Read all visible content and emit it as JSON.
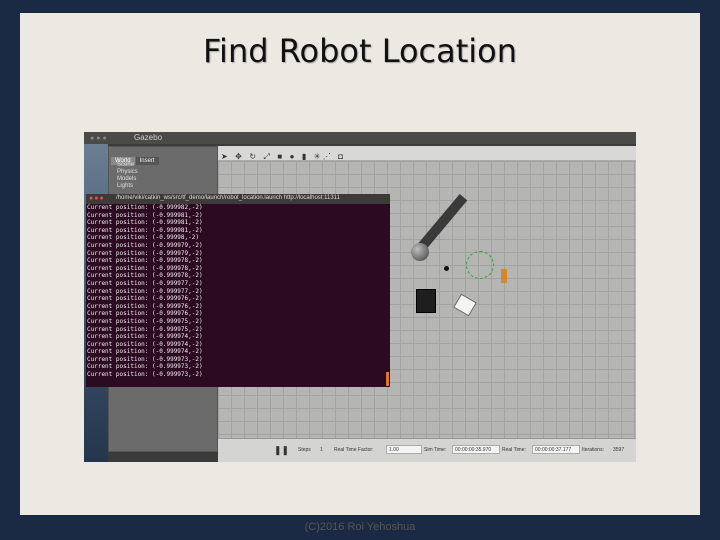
{
  "slide": {
    "title": "Find Robot Location",
    "footer": "(C)2016 Roi Yehoshua"
  },
  "gazebo": {
    "window_title": "Gazebo",
    "tabs": [
      "World",
      "Insert"
    ],
    "tree_items": [
      "Scene",
      "Physics",
      "Models",
      "Lights"
    ],
    "toolbar_icons": [
      "select-arrow-icon",
      "translate-icon",
      "rotate-icon",
      "scale-icon",
      "box-icon",
      "sphere-icon",
      "cylinder-icon",
      "light-icons",
      "screenshot-icon"
    ],
    "bottom": {
      "steps_label": "Steps",
      "steps_value": "1",
      "real_time_factor_label": "Real Time Factor:",
      "real_time_factor_value": "1.00",
      "sim_time_label": "Sim Time:",
      "sim_time_value": "00:00:00:35.970",
      "real_time_label": "Real Time:",
      "real_time_value": "00:00:00:37.177",
      "iterations_label": "Iterations:",
      "iterations_value": "3597"
    }
  },
  "terminal": {
    "title": "/home/viki/catkin_ws/src/tf_demo/launch/robot_location.launch http://localhost:11311",
    "lines": [
      "Current position: (-0.999982,-2)",
      "Current position: (-0.999981,-2)",
      "Current position: (-0.999981,-2)",
      "Current position: (-0.999981,-2)",
      "Current position: (-0.99998,-2)",
      "Current position: (-0.999979,-2)",
      "Current position: (-0.999979,-2)",
      "Current position: (-0.999978,-2)",
      "Current position: (-0.999978,-2)",
      "Current position: (-0.999978,-2)",
      "Current position: (-0.999977,-2)",
      "Current position: (-0.999977,-2)",
      "Current position: (-0.999976,-2)",
      "Current position: (-0.999976,-2)",
      "Current position: (-0.999976,-2)",
      "Current position: (-0.999975,-2)",
      "Current position: (-0.999975,-2)",
      "Current position: (-0.999974,-2)",
      "Current position: (-0.999974,-2)",
      "Current position: (-0.999974,-2)",
      "Current position: (-0.999973,-2)",
      "Current position: (-0.999973,-2)",
      "Current position: (-0.999973,-2)"
    ]
  }
}
